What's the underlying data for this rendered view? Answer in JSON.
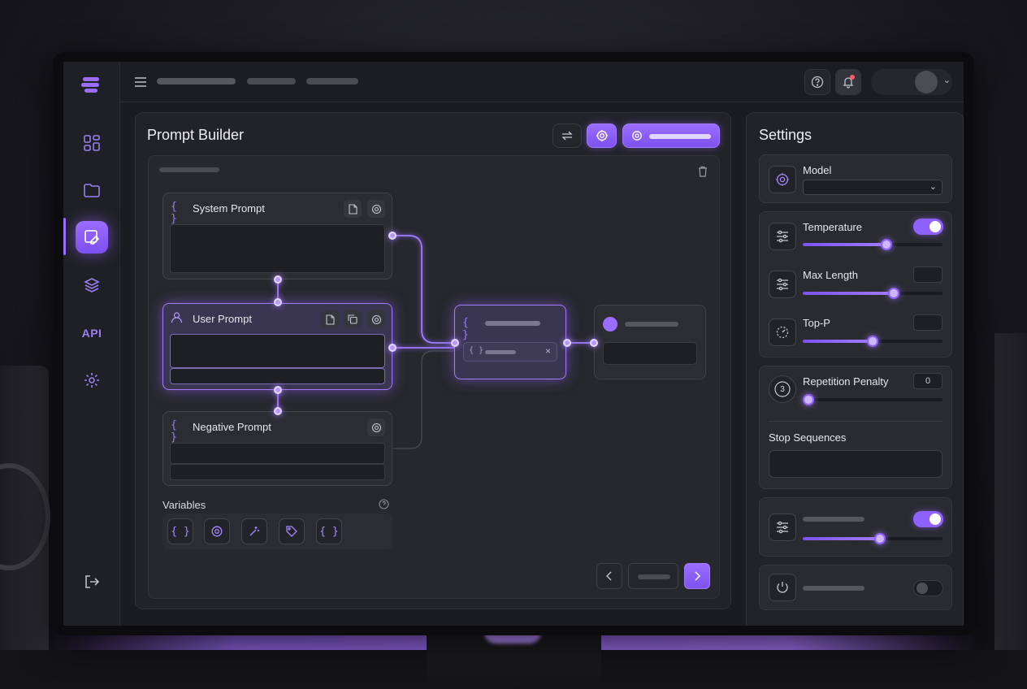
{
  "sidebar": {
    "api_label": "API",
    "icons": [
      "logo-icon",
      "dashboard-icon",
      "folder-icon",
      "prompt-edit-icon",
      "layers-icon",
      "api-icon",
      "settings-gear-icon",
      "logout-icon"
    ],
    "active_item": "prompt-edit-icon"
  },
  "topbar": {
    "icons": [
      "menu-icon",
      "help-icon",
      "bell-icon"
    ],
    "has_notification": true
  },
  "builder": {
    "title": "Prompt Builder",
    "nodes": {
      "system": {
        "label": "System Prompt"
      },
      "user": {
        "label": "User Prompt"
      },
      "negative": {
        "label": "Negative Prompt"
      }
    },
    "variables_label": "Variables",
    "variable_chips": [
      "{ }",
      "gear",
      "sparkle",
      "tag",
      "{ }"
    ]
  },
  "settings": {
    "title": "Settings",
    "model_label": "Model",
    "temperature_label": "Temperature",
    "temperature_enabled": true,
    "temperature_value": 0.6,
    "max_length_label": "Max Length",
    "max_length_value": 0.65,
    "top_p_label": "Top-P",
    "top_p_value": 0.5,
    "repetition_penalty_label": "Repetition Penalty",
    "repetition_penalty_icon_text": "3",
    "repetition_penalty_value": "0",
    "repetition_penalty_slider": 0.0,
    "stop_sequences_label": "Stop Sequences",
    "extra_toggle_enabled": true,
    "extra_slider_value": 0.55,
    "power_toggle_enabled": false
  },
  "colors": {
    "accent": "#9b6dff",
    "accent_dark": "#7d52f0",
    "background": "#1b1c21",
    "panel": "#222328",
    "notification": "#ff5a6a"
  }
}
